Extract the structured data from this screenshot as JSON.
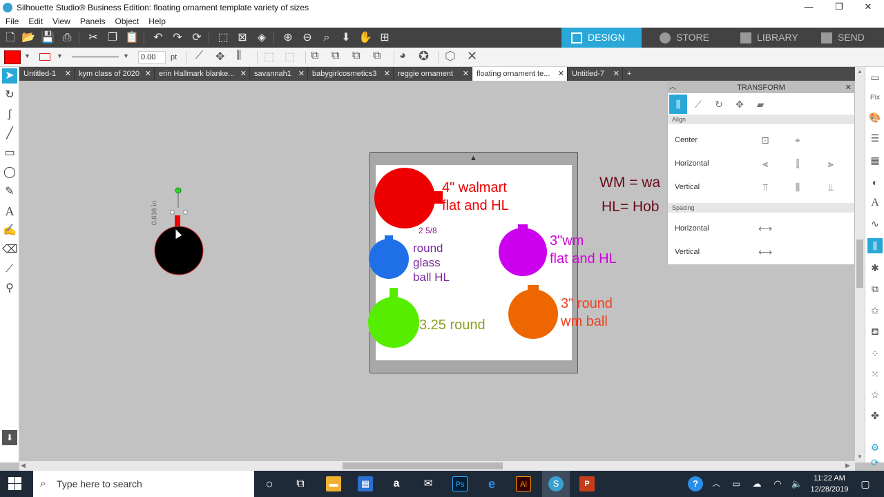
{
  "window": {
    "title": "Silhouette Studio® Business Edition: floating ornament template variety of sizes",
    "minimize": "—",
    "maximize": "❐",
    "close": "✕"
  },
  "menu": [
    "File",
    "Edit",
    "View",
    "Panels",
    "Object",
    "Help"
  ],
  "nav_tabs": [
    {
      "label": "DESIGN",
      "icon": "grid-icon"
    },
    {
      "label": "STORE",
      "icon": "silhouette-s-icon"
    },
    {
      "label": "LIBRARY",
      "icon": "library-download-icon"
    },
    {
      "label": "SEND",
      "icon": "send-icon"
    }
  ],
  "toolbar2": {
    "fill_color": "#ff0000",
    "line_width_value": "0.00",
    "line_width_unit": "pt"
  },
  "doc_tabs": [
    {
      "label": "Untitled-1"
    },
    {
      "label": "kym class of 2020"
    },
    {
      "label": "erin Hallmark blanke..."
    },
    {
      "label": "savannah1"
    },
    {
      "label": "babygirlcosmetics3"
    },
    {
      "label": "reggie ornament"
    },
    {
      "label": "floating ornament te..."
    },
    {
      "label": "Untitled-7"
    }
  ],
  "doc_tab_close": "✕",
  "doc_tab_add": "+",
  "canvas": {
    "selection_dimension": "0.636 in",
    "labels": {
      "walmart_4": "4\" walmart",
      "walmart_4b": "flat and HL",
      "size_258": "2 5/8",
      "round_glass_1": "round",
      "round_glass_2": "glass",
      "round_glass_3": "ball HL",
      "wm_3_1": "3\"wm",
      "wm_3_2": "flat and HL",
      "round_325": "3.25 round",
      "round_3_1": "3\" round",
      "round_3_2": "wm ball",
      "legend_wm": "WM = wa",
      "legend_hl": "HL= Hob"
    },
    "colors": {
      "red": "#ee0000",
      "blue": "#1f6fe8",
      "purple": "#cc00ee",
      "green": "#55ee00",
      "orange": "#ee6600",
      "black": "#000000"
    }
  },
  "transform_panel": {
    "title": "TRANSFORM",
    "close": "✕",
    "section_align": "Align",
    "center_label": "Center",
    "horizontal_label": "Horizontal",
    "vertical_label": "Vertical",
    "section_spacing": "Spacing",
    "spacing_horizontal_label": "Horizontal",
    "spacing_vertical_label": "Vertical"
  },
  "taskbar": {
    "search_placeholder": "Type here to search",
    "time": "11:22 AM",
    "date": "12/28/2019"
  }
}
